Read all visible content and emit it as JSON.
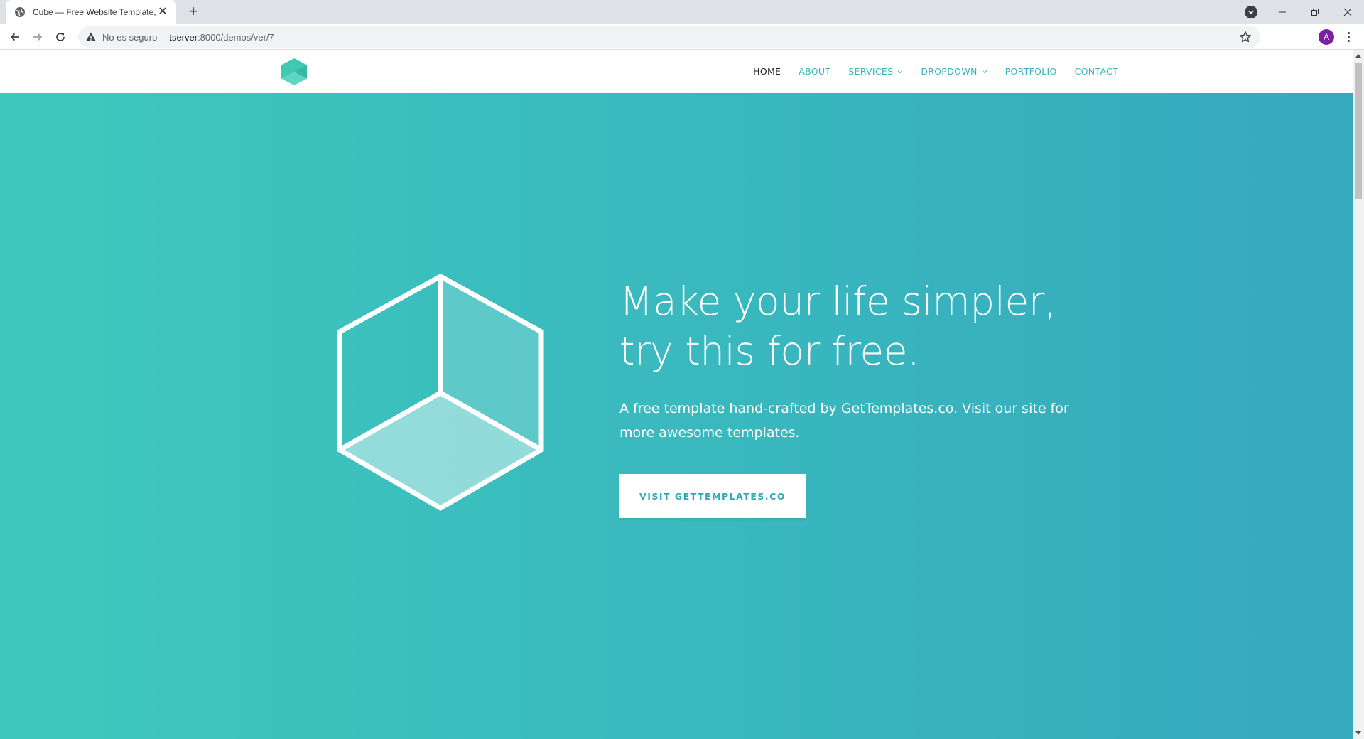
{
  "browser": {
    "tab_title": "Cube — Free Website Template, Fr",
    "security_label": "No es seguro",
    "url_host": "tserver",
    "url_path": ":8000/demos/ver/7",
    "profile_initial": "A"
  },
  "site": {
    "nav": [
      {
        "label": "HOME",
        "active": true
      },
      {
        "label": "ABOUT"
      },
      {
        "label": "SERVICES",
        "dropdown": true
      },
      {
        "label": "DROPDOWN",
        "dropdown": true
      },
      {
        "label": "PORTFOLIO"
      },
      {
        "label": "CONTACT"
      }
    ],
    "hero": {
      "headline_line1": "Make your life simpler,",
      "headline_line2": "try this for free.",
      "subtext": "A free template hand-crafted by GetTemplates.co. Visit our site for more awesome templates.",
      "cta_label": "VISIT GETTEMPLATES.CO"
    }
  },
  "colors": {
    "accent": "#3bb3b8",
    "hero_gradient_start": "#3ec9bd",
    "hero_gradient_end": "#35a9be",
    "profile": "#7b1fa2"
  }
}
